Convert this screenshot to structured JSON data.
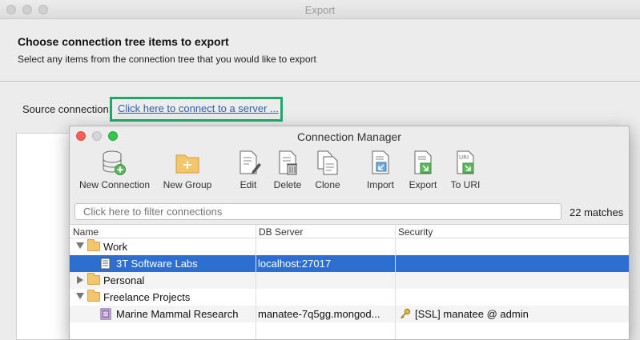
{
  "export_window": {
    "title": "Export",
    "header_title": "Choose connection tree items to export",
    "header_subtitle": "Select any items from the connection tree that you would like to export",
    "source_label": "Source connection:",
    "source_link": "Click here to connect to a server ..."
  },
  "connection_manager": {
    "title": "Connection Manager",
    "toolbar": {
      "new_connection": "New Connection",
      "new_group": "New Group",
      "edit": "Edit",
      "delete": "Delete",
      "clone": "Clone",
      "import": "Import",
      "export": "Export",
      "to_uri": "To URI"
    },
    "filter_placeholder": "Click here to filter connections",
    "matches": "22 matches",
    "columns": {
      "name": "Name",
      "db_server": "DB Server",
      "security": "Security"
    },
    "rows": [
      {
        "name": "Work",
        "db_server": "",
        "security": ""
      },
      {
        "name": "3T Software Labs",
        "db_server": "localhost:27017",
        "security": ""
      },
      {
        "name": "Personal",
        "db_server": "",
        "security": ""
      },
      {
        "name": "Freelance Projects",
        "db_server": "",
        "security": ""
      },
      {
        "name": "Marine Mammal Research",
        "db_server": "manatee-7q5gg.mongod...",
        "security": "[SSL] manatee @ admin"
      }
    ]
  },
  "colors": {
    "selection": "#2c6fd1",
    "highlight_box": "#1faa6b",
    "link": "#2a5db0"
  }
}
